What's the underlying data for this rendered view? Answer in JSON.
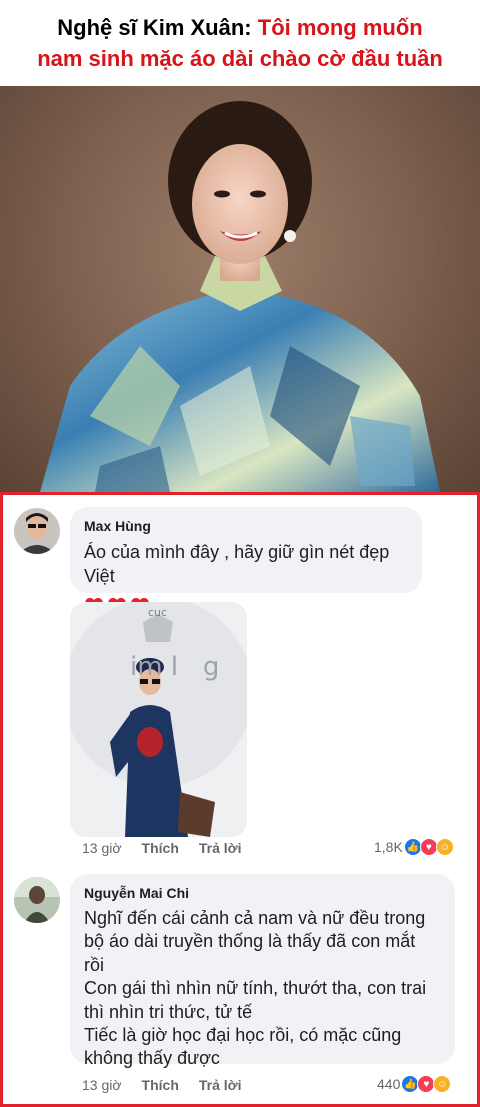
{
  "headline": {
    "prefix": "Nghệ sĩ Kim Xuân: ",
    "highlight_line1": "Tôi mong muốn",
    "line2": "nam sinh mặc áo dài chào cờ đầu tuần",
    "colors": {
      "text": "#000000",
      "highlight": "#d8141a"
    }
  },
  "photo": {
    "description_icon": "portrait-photo"
  },
  "frame_color": "#e0232b",
  "comments": [
    {
      "author": "Max Hùng",
      "lines": [
        "Áo của mình đây , hãy giữ gìn nét đẹp Việt"
      ],
      "hearts": 3,
      "attachment": {
        "overlay_text_top": "cuc",
        "overlay_text_brand": "im l   g"
      },
      "time": "13 giờ",
      "like_label": "Thích",
      "reply_label": "Trả lời",
      "reaction_count": "1,8K"
    },
    {
      "author": "Nguyễn Mai Chi",
      "lines": [
        "Nghĩ đến cái cảnh cả nam và nữ đều trong",
        "bộ áo dài truyền thống là thấy đã con mắt",
        "rồi",
        "Con gái thì nhìn nữ tính, thướt tha, con trai",
        "thì nhìn tri thức, tử tế",
        "Tiếc là giờ học đại học rồi, có mặc cũng",
        "không thấy được"
      ],
      "time": "13 giờ",
      "like_label": "Thích",
      "reply_label": "Trả lời",
      "reaction_count": "440"
    }
  ],
  "reaction_icons": [
    "like-icon",
    "love-icon",
    "care-icon"
  ]
}
